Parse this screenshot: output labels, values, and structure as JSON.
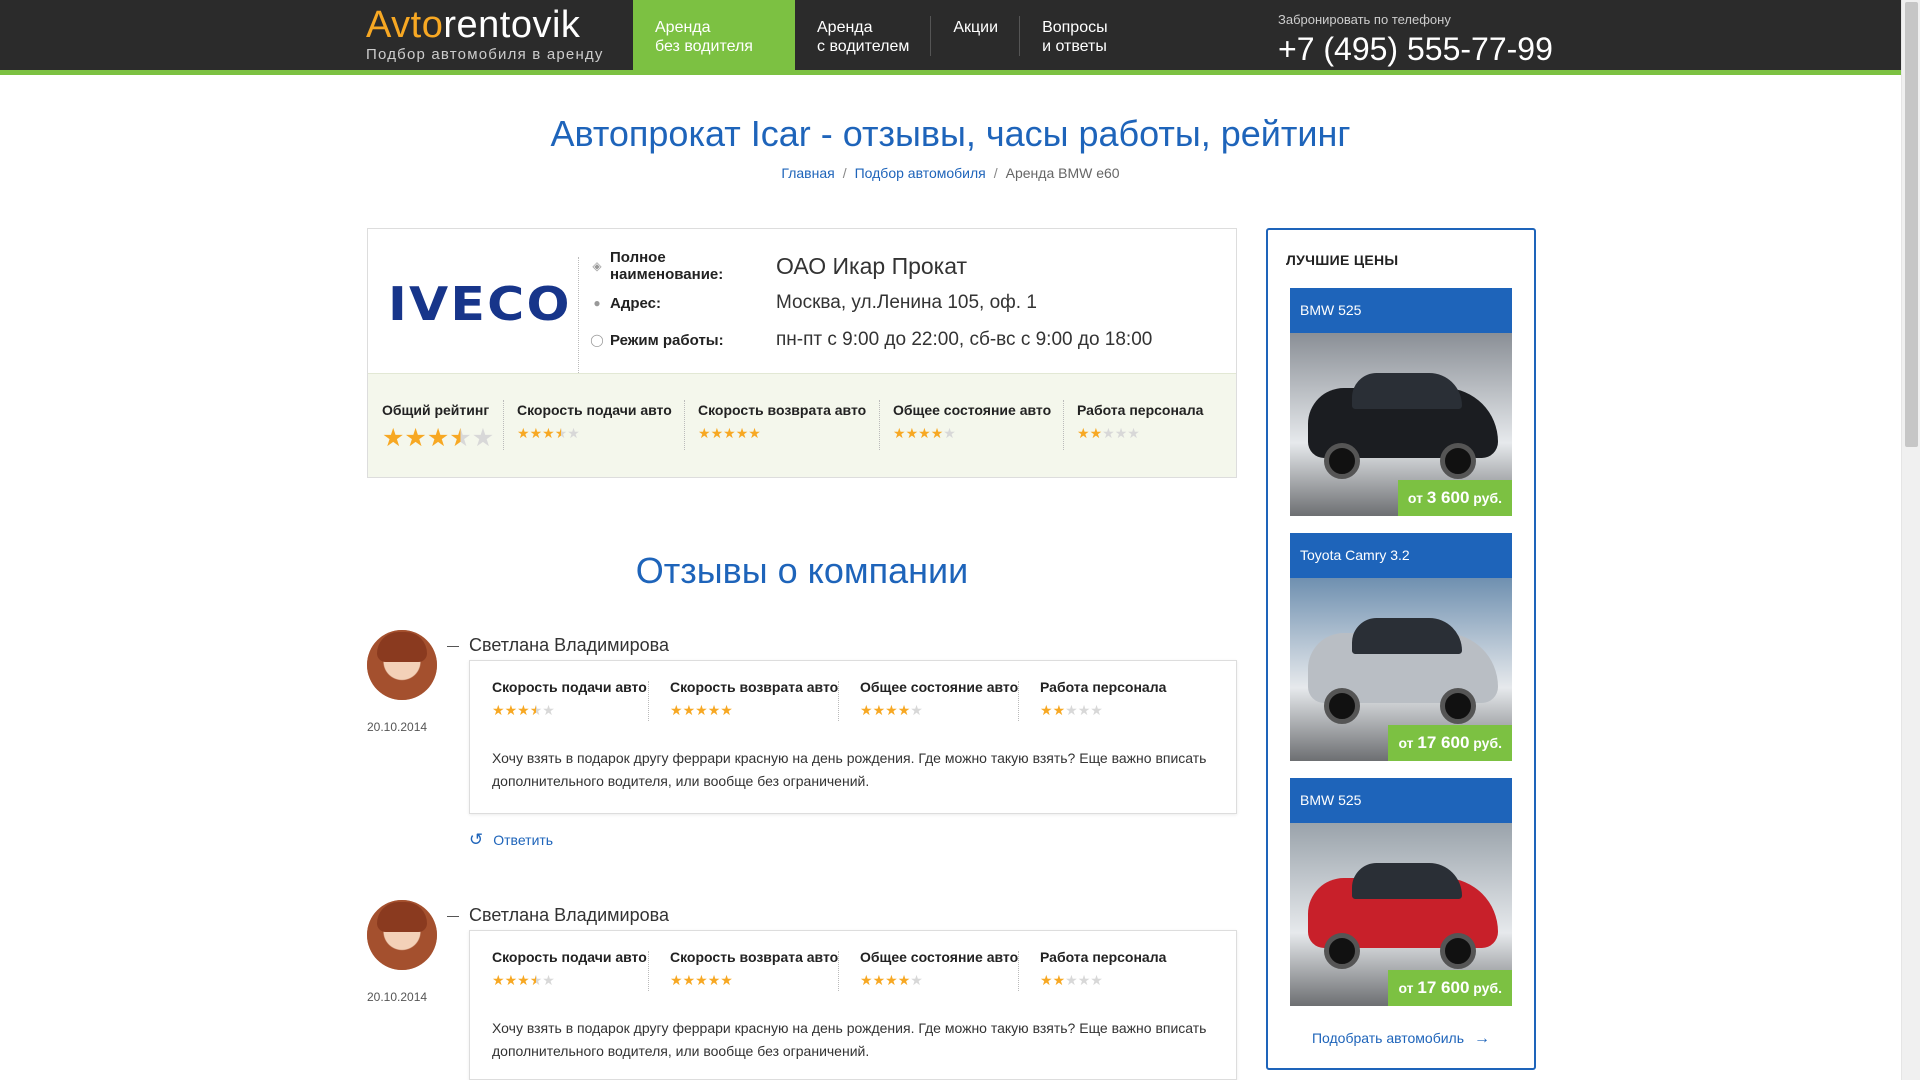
{
  "header": {
    "logo_part1": "Avto",
    "logo_part2": "rentovik",
    "logo_tagline": "Подбор автомобиля в аренду",
    "nav": [
      {
        "line1": "Аренда",
        "line2": "без водителя",
        "active": true
      },
      {
        "line1": "Аренда",
        "line2": "с водителем",
        "active": false
      },
      {
        "line1": "Акции",
        "line2": "",
        "active": false
      },
      {
        "line1": "Вопросы",
        "line2": "и ответы",
        "active": false
      }
    ],
    "phone_label": "Забронировать по телефону",
    "phone_number": "+7 (495) 555-77-99"
  },
  "page": {
    "title": "Автопрокат Icar - отзывы, часы работы, рейтинг",
    "breadcrumb": [
      "Главная",
      "Подбор автомобиля",
      "Аренда BMW e60"
    ]
  },
  "company": {
    "logo_text": "IVECO",
    "fields": [
      {
        "icon": "megaphone-icon",
        "label": "Полное наименование:",
        "value": "ОАО Икар Прокат"
      },
      {
        "icon": "map-pin-icon",
        "label": "Адрес:",
        "value": "Москва, ул.Ленина 105, оф. 1"
      },
      {
        "icon": "clock-icon",
        "label": "Режим работы:",
        "value": "пн-пт с 9:00 до 22:00, сб-вс с 9:00 до 18:00"
      }
    ],
    "ratings": [
      {
        "label": "Общий рейтинг",
        "stars": 3.5
      },
      {
        "label": "Скорость подачи авто",
        "stars": 3.5
      },
      {
        "label": "Скорость возврата авто",
        "stars": 5
      },
      {
        "label": "Общее состояние авто",
        "stars": 4
      },
      {
        "label": "Работа персонала",
        "stars": 2
      }
    ]
  },
  "reviews_section": {
    "title": "Отзывы о компании",
    "reviews": [
      {
        "author": "Светлана Владимирова",
        "date": "20.10.2014",
        "ratings": [
          {
            "label": "Скорость подачи авто",
            "stars": 3.5
          },
          {
            "label": "Скорость возврата авто",
            "stars": 5
          },
          {
            "label": "Общее состояние авто",
            "stars": 4
          },
          {
            "label": "Работа персонала",
            "stars": 2
          }
        ],
        "text": "Хочу взять в подарок другу феррари красную на день рождения. Где можно такую взять? Еще важно вписать дополнительного водителя, или вообще без ограничений.",
        "reply_label": "Ответить"
      },
      {
        "author": "Светлана Владимирова",
        "date": "20.10.2014",
        "ratings": [
          {
            "label": "Скорость подачи авто",
            "stars": 3.5
          },
          {
            "label": "Скорость возврата авто",
            "stars": 5
          },
          {
            "label": "Общее состояние авто",
            "stars": 4
          },
          {
            "label": "Работа персонала",
            "stars": 2
          }
        ],
        "text": "Хочу взять в подарок другу феррари красную на день рождения. Где можно такую взять? Еще важно вписать дополнительного водителя, или вообще без ограничений."
      }
    ]
  },
  "sidebar": {
    "title": "ЛУЧШИЕ ЦЕНЫ",
    "cars": [
      {
        "name": "BMW 525",
        "price_prefix": "от",
        "price_value": "3 600",
        "price_suffix": "руб.",
        "car_color": "#1b1d21",
        "bg": "#8a8f96"
      },
      {
        "name": "Toyota Camry 3.2",
        "price_prefix": "от",
        "price_value": "17 600",
        "price_suffix": "руб.",
        "car_color": "#b9bec4",
        "bg": "#6f90b0"
      },
      {
        "name": "BMW 525",
        "price_prefix": "от",
        "price_value": "17 600",
        "price_suffix": "руб.",
        "car_color": "#c8202a",
        "bg": "#9aa3ab"
      }
    ],
    "link_label": "Подобрать автомобиль"
  },
  "colors": {
    "brand_blue": "#1e64ba",
    "accent_green": "#7cc142",
    "logo_orange": "#f7a823",
    "header_bg": "#2b2b2b",
    "star": "#f7a823"
  }
}
